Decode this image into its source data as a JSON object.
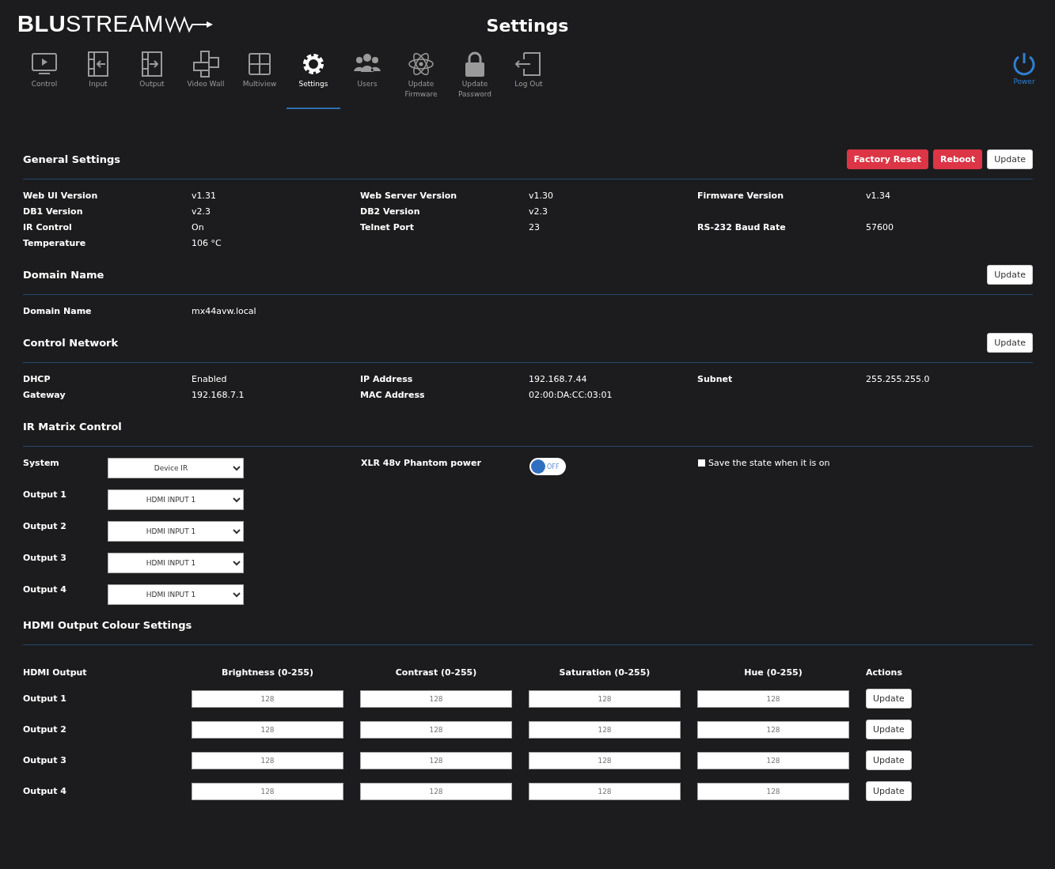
{
  "header": {
    "logo": "**BLU**STREAM",
    "title": "Settings"
  },
  "nav": [
    {
      "label": "Control",
      "kind": "monitor",
      "selected": false
    },
    {
      "label": "Input",
      "kind": "input",
      "selected": false
    },
    {
      "label": "Output",
      "kind": "output",
      "selected": false
    },
    {
      "label": "Video Wall",
      "kind": "wall",
      "selected": false
    },
    {
      "label": "Multiview",
      "kind": "grid",
      "selected": false
    },
    {
      "label": "Settings",
      "kind": "gear",
      "selected": true
    },
    {
      "label": "Users",
      "kind": "users",
      "selected": false
    },
    {
      "label": "Update Firmware",
      "kind": "atom",
      "selected": false
    },
    {
      "label": "Update Password",
      "kind": "lock",
      "selected": false
    },
    {
      "label": "Log Out",
      "kind": "logout",
      "selected": false
    }
  ],
  "power": {
    "label": "Power"
  },
  "general": {
    "title": "General Settings",
    "buttons": [
      {
        "label": "Factory Reset",
        "kind": "danger"
      },
      {
        "label": "Reboot",
        "kind": "danger"
      },
      {
        "label": "Update",
        "kind": "plain"
      }
    ],
    "rows": [
      [
        {
          "label": "Web UI Version",
          "value": "v1.31"
        },
        {
          "label": "Web Server Version",
          "value": "v1.30"
        },
        {
          "label": "Firmware Version",
          "value": "v1.34"
        }
      ],
      [
        {
          "label": "DB1 Version",
          "value": "v2.3"
        },
        {
          "label": "DB2 Version",
          "value": "v2.3"
        }
      ],
      [
        {
          "label": "IR Control",
          "value": "On"
        },
        {
          "label": "Telnet Port",
          "value": "23"
        },
        {
          "label": "RS-232 Baud Rate",
          "value": "57600"
        }
      ],
      [
        {
          "label": "Temperature",
          "value": "106 °C"
        }
      ]
    ]
  },
  "domain": {
    "title": "Domain Name",
    "button": "Update",
    "rows": [
      [
        {
          "label": "Domain Name",
          "value": "mx44avw.local"
        }
      ]
    ]
  },
  "network": {
    "title": "Control Network",
    "button": "Update",
    "rows": [
      [
        {
          "label": "DHCP",
          "value": "Enabled"
        },
        {
          "label": "IP Address",
          "value": "192.168.7.44"
        },
        {
          "label": "Subnet",
          "value": "255.255.255.0"
        }
      ],
      [
        {
          "label": "Gateway",
          "value": "192.168.7.1"
        },
        {
          "label": "MAC Address",
          "value": "02:00:DA:CC:03:01"
        }
      ]
    ]
  },
  "ir": {
    "title": "IR Matrix Control",
    "rows": [
      {
        "label": "System",
        "value": "Device IR"
      },
      {
        "label": "Output 1",
        "value": "HDMI INPUT 1"
      },
      {
        "label": "Output 2",
        "value": "HDMI INPUT 1"
      },
      {
        "label": "Output 3",
        "value": "HDMI INPUT 1"
      },
      {
        "label": "Output 4",
        "value": "HDMI INPUT 1"
      }
    ],
    "phantom": {
      "label": "XLR 48v Phantom power",
      "on": false,
      "state_text": "OFF"
    },
    "save": {
      "label": "Save the state when it is on",
      "checked": false
    }
  },
  "colour": {
    "title": "HDMI Output Colour Settings",
    "columns": [
      "HDMI Output",
      "Brightness (0-255)",
      "Contrast (0-255)",
      "Saturation (0-255)",
      "Hue (0-255)",
      "Actions"
    ],
    "rows": [
      {
        "output": "Output 1",
        "values": [
          "128",
          "128",
          "128",
          "128"
        ],
        "button": "Update"
      },
      {
        "output": "Output 2",
        "values": [
          "128",
          "128",
          "128",
          "128"
        ],
        "button": "Update"
      },
      {
        "output": "Output 3",
        "values": [
          "128",
          "128",
          "128",
          "128"
        ],
        "button": "Update"
      },
      {
        "output": "Output 4",
        "values": [
          "128",
          "128",
          "128",
          "128"
        ],
        "button": "Update"
      }
    ]
  }
}
